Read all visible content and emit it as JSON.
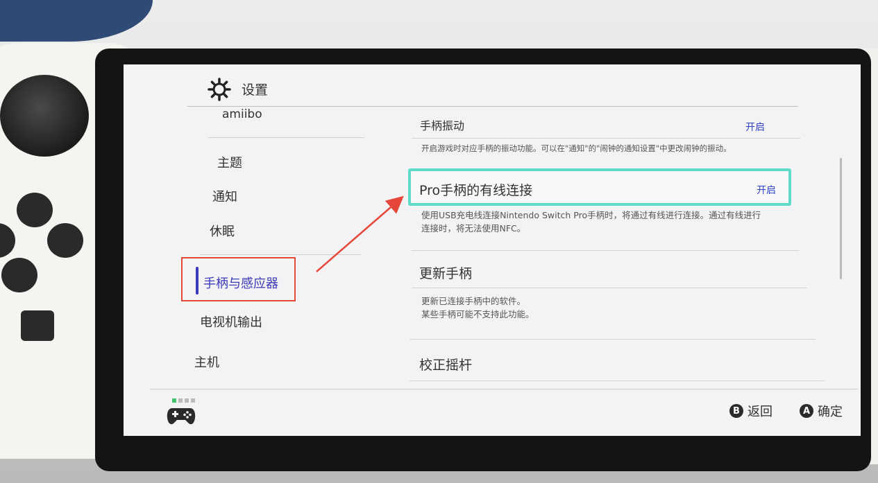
{
  "header": {
    "title": "设置",
    "icon": "gear-icon"
  },
  "sidebar": {
    "items": [
      {
        "label": "amiibo"
      },
      {
        "label": "主题"
      },
      {
        "label": "通知"
      },
      {
        "label": "休眠"
      },
      {
        "label": "手柄与感应器",
        "selected": true
      },
      {
        "label": "电视机输出"
      },
      {
        "label": "主机"
      }
    ]
  },
  "content": {
    "rows": [
      {
        "title": "手柄振动",
        "value": "开启",
        "description": "开启游戏时对应手柄的振动功能。可以在\"通知\"的\"闹钟的通知设置\"中更改闹钟的振动。"
      },
      {
        "title": "Pro手柄的有线连接",
        "value": "开启",
        "description_line1": "使用USB充电线连接Nintendo Switch Pro手柄时，将通过有线进行连接。通过有线进行",
        "description_line2": "连接时，将无法使用NFC。"
      },
      {
        "title": "更新手柄",
        "description_line1": "更新已连接手柄中的软件。",
        "description_line2": "某些手柄可能不支持此功能。"
      },
      {
        "title": "校正摇杆"
      }
    ]
  },
  "footer": {
    "back_key": "B",
    "back_label": "返回",
    "ok_key": "A",
    "ok_label": "确定",
    "controller_icon": "gamepad-icon"
  },
  "colors": {
    "accent_blue": "#2f44c8",
    "focus_teal": "#5fdcc7",
    "annotation_red": "#e5483a",
    "active_dot": "#42c26b"
  }
}
